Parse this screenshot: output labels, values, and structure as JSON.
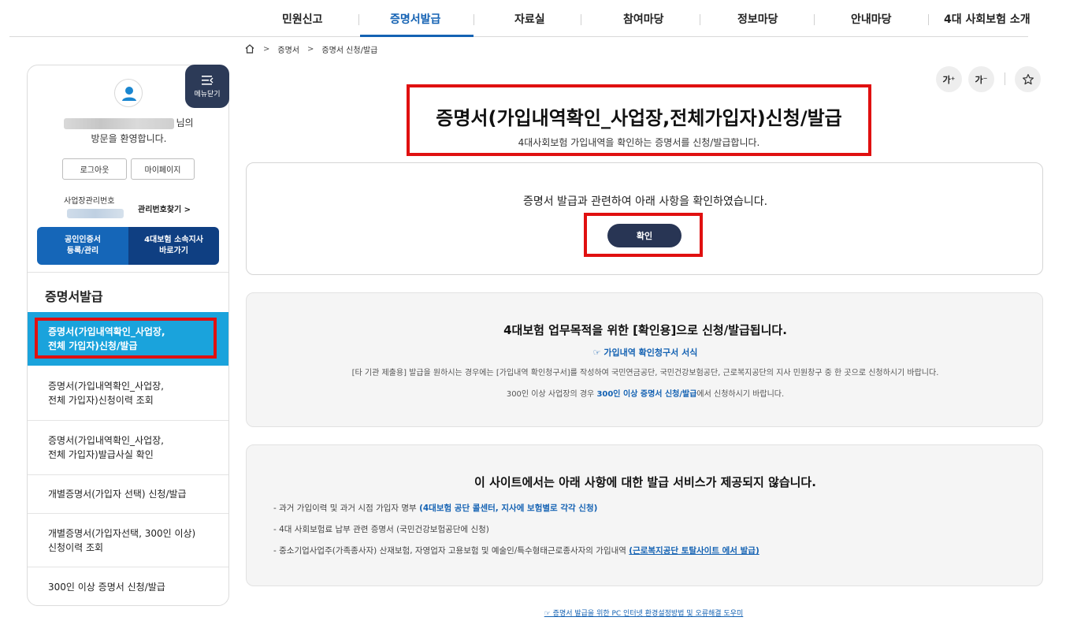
{
  "top_nav": {
    "items": [
      "민원신고",
      "증명서발급",
      "자료실",
      "참여마당",
      "정보마당",
      "안내마당",
      "4대 사회보험 소개"
    ],
    "active": "증명서발급"
  },
  "breadcrumb": {
    "home_icon": "home-icon",
    "items": [
      "증명서",
      "증명서 신청/발급"
    ],
    "separator": ">"
  },
  "sidebar": {
    "menu_toggle_label": "메뉴닫기",
    "welcome_suffix": "님의",
    "welcome_line2": "방문을 환영합니다.",
    "logout_label": "로그아웃",
    "mypage_label": "마이페이지",
    "mgmt_no_label": "사업장관리번호",
    "find_mgmt_no_label": "관리번호찾기 >",
    "cert_btn": [
      "공인인증서",
      "등록/관리"
    ],
    "branch_btn": [
      "4대보험 소속지사",
      "바로가기"
    ],
    "section_title": "증명서발급",
    "menu": [
      [
        "증명서(가입내역확인_사업장,",
        "전체 가입자)신청/발급"
      ],
      [
        "증명서(가입내역확인_사업장,",
        "전체 가입자)신청이력 조회"
      ],
      [
        "증명서(가입내역확인_사업장,",
        "전체 가입자)발급사실 확인"
      ],
      [
        "개별증명서(가입자 선택) 신청/발급"
      ],
      [
        "개별증명서(가입자선택, 300인 이상)",
        "신청이력 조회"
      ],
      [
        "300인 이상 증명서 신청/발급"
      ]
    ]
  },
  "tools": {
    "font_up": "가⁺",
    "font_down": "가⁻",
    "favorite_icon": "star-icon"
  },
  "main": {
    "title": "증명서(가입내역확인_사업장,전체가입자)신청/발급",
    "subtitle": "4대사회보험 가입내역을 확인하는 증명서를 신청/발급합니다.",
    "confirm_text": "증명서 발급과 관련하여 아래 사항을 확인하였습니다.",
    "confirm_button": "확인"
  },
  "info1": {
    "heading": "4대보험 업무목적을 위한 [확인용]으로 신청/발급됩니다.",
    "link": "☞ 가입내역 확인청구서 서식",
    "line1": "[타 기관 제출용] 발급을 원하시는 경우에는 [가입내역 확인청구서]를 작성하여 국민연금공단, 국민건강보험공단, 근로복지공단의 지사 민원창구 중 한 곳으로 신청하시기 바랍니다.",
    "line2_pre": "300인 이상 사업장의 경우 ",
    "line2_link": "300인 이상 증명서 신청/발급",
    "line2_post": "에서 신청하시기 바랍니다."
  },
  "info2": {
    "heading": "이 사이트에서는 아래 사항에 대한 발급 서비스가 제공되지 않습니다.",
    "items": [
      {
        "text": "- 과거 가입이력 및 과거 시점 가입자 명부 ",
        "link": "(4대보험 공단 콜센터, 지사에 보험별로 각각 신청)"
      },
      {
        "text": "- 4대 사회보험료 납부 관련 증명서 (국민건강보험공단에 신청)",
        "link": ""
      },
      {
        "text": "- 중소기업사업주(가족종사자) 산재보험, 자영업자 고용보험 및 예술인/특수형태근로종사자의 가입내역  ",
        "link": "(근로복지공단 토탈사이트 에서 발급)"
      }
    ]
  },
  "bottom_link": "☞ 증명서 발급을 위한 PC 인터넷 환경설정방법 및 오류해결 도우미",
  "highlight_color": "#e01010",
  "accent_color": "#1462b3"
}
